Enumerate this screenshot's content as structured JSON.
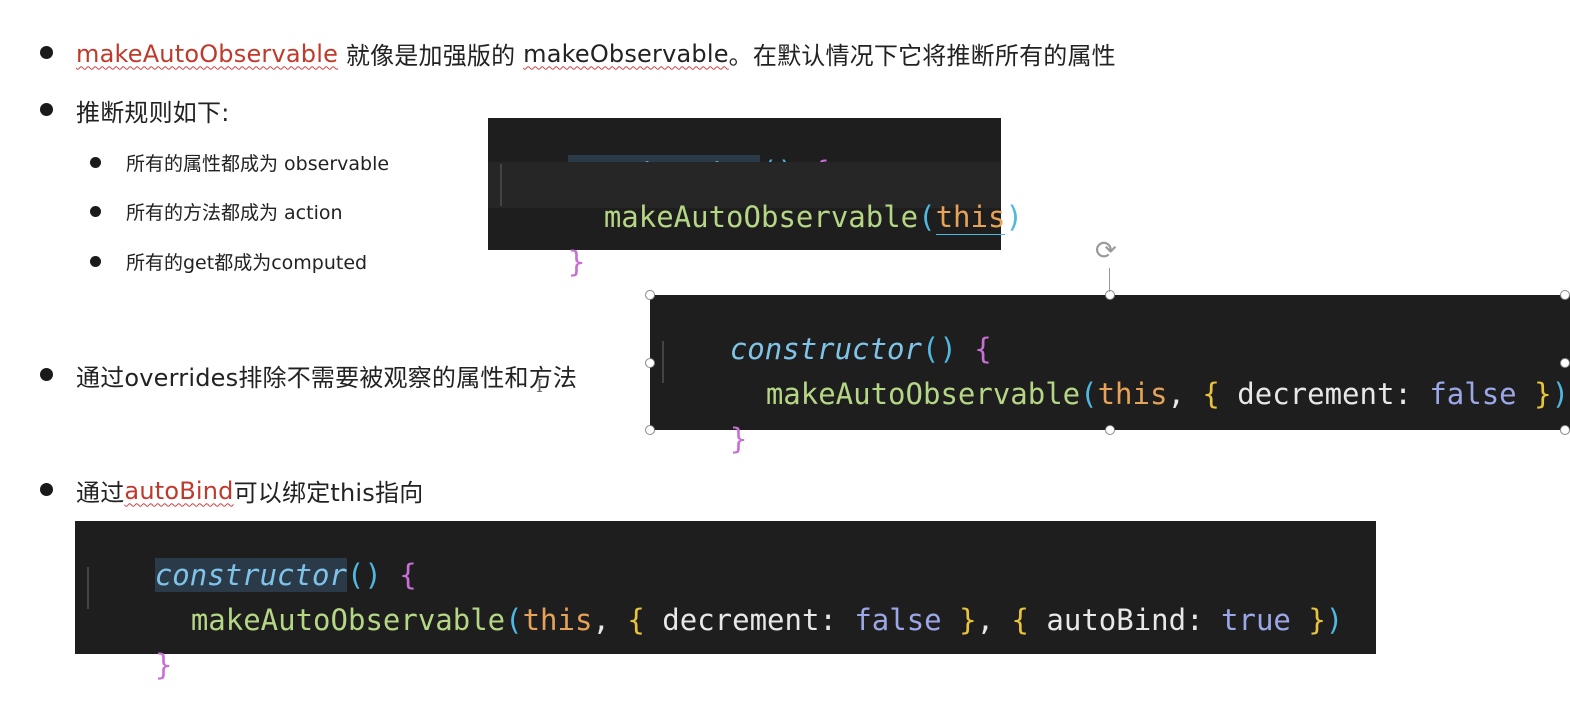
{
  "bullets": {
    "b1": {
      "part1": "makeAutoObservable",
      "part2": " 就像是加强版的 ",
      "part3": "makeObservable",
      "part4": "。在默认情况下它将推断所有的属性"
    },
    "b2": {
      "text": "推断规则如下:"
    },
    "sub": [
      {
        "text": "所有的属性都成为 observable"
      },
      {
        "text": "所有的方法都成为 action"
      },
      {
        "text": "所有的get都成为computed"
      }
    ],
    "b3": {
      "text": "通过overrides排除不需要被观察的属性和方法"
    },
    "b4": {
      "part1": "通过",
      "part2": "autoBind",
      "part3": "可以绑定this指向"
    }
  },
  "code1": {
    "line1": {
      "ctor": "constructor",
      "paren": "()",
      "brace": " {"
    },
    "line2": {
      "fn": "makeAutoObservable",
      "open": "(",
      "this": "this",
      "close": ")"
    },
    "line3": {
      "brace": "}"
    }
  },
  "code2": {
    "line1": {
      "ctor": "constructor",
      "paren": "()",
      "brace": " {"
    },
    "line2": {
      "fn": "makeAutoObservable",
      "open": "(",
      "this": "this",
      "comma": ", ",
      "ob": "{",
      "key": " decrement: ",
      "val": "false",
      "cb": " }",
      "close": ")"
    },
    "line3": {
      "brace": "}"
    }
  },
  "code3": {
    "line1": {
      "ctor": "constructor",
      "paren": "()",
      "brace": " {"
    },
    "line2": {
      "fn": "makeAutoObservable",
      "open": "(",
      "this": "this",
      "comma": ", ",
      "ob1": "{",
      "key1": " decrement: ",
      "val1": "false",
      "cb1": " }",
      "comma2": ", ",
      "ob2": "{",
      "key2": " autoBind: ",
      "val2": "true",
      "cb2": " }",
      "close": ")"
    },
    "line3": {
      "brace": "}"
    }
  },
  "icons": {
    "rotate": "rotate-handle-icon",
    "cursor": "text-cursor-icon"
  }
}
